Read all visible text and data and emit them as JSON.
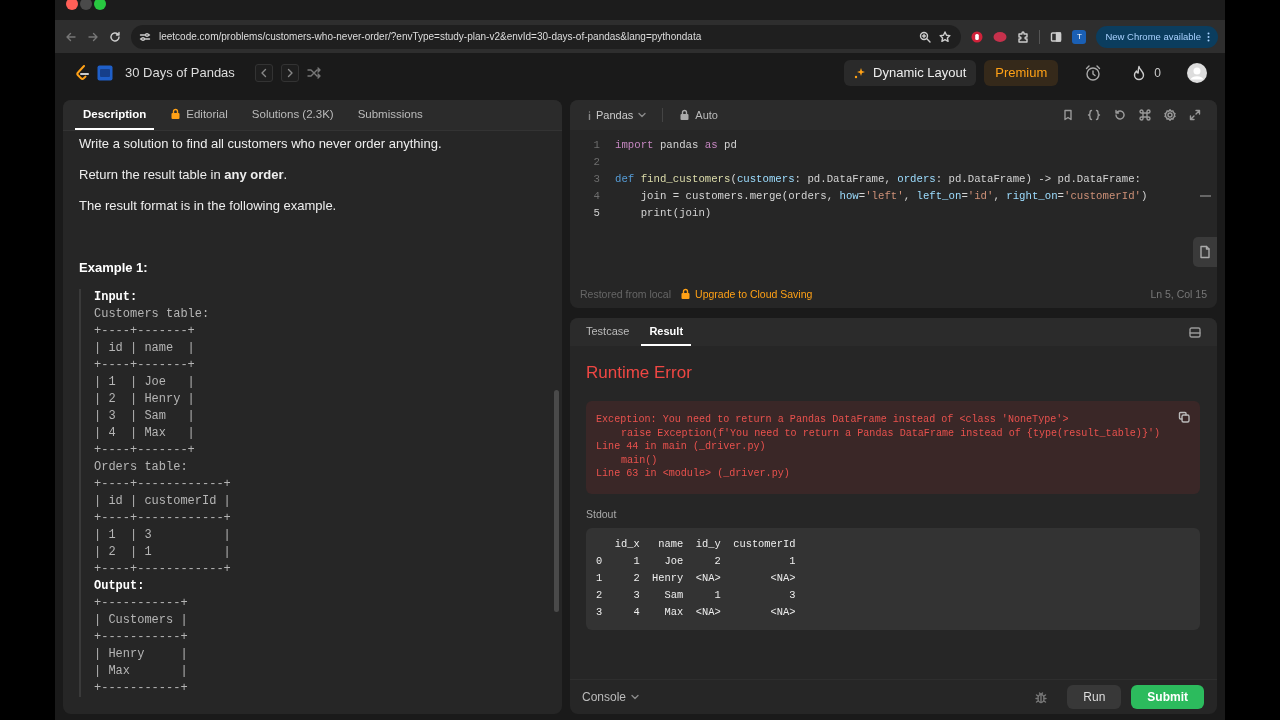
{
  "browser": {
    "url": "leetcode.com/problems/customers-who-never-order/?envType=study-plan-v2&envId=30-days-of-pandas&lang=pythondata",
    "profile_initial": "T",
    "update_button": "New Chrome available"
  },
  "header": {
    "title": "30 Days of Pandas",
    "dynamic_layout": "Dynamic Layout",
    "premium": "Premium",
    "streak": "0"
  },
  "description_tabs": [
    {
      "label": "Description",
      "selected": true,
      "locked": false
    },
    {
      "label": "Editorial",
      "selected": false,
      "locked": true
    },
    {
      "label": "Solutions (2.3K)",
      "selected": false,
      "locked": false
    },
    {
      "label": "Submissions",
      "selected": false,
      "locked": false
    }
  ],
  "description": {
    "paragraphs": [
      "Write a solution to find all customers who never order anything.",
      "Return the result table in **any order**.",
      "The result format is in the following example."
    ],
    "example_title": "Example 1:",
    "example_lines": [
      {
        "text": "Input:",
        "bold": true
      },
      {
        "text": "Customers table:",
        "bold": false
      },
      {
        "text": "+----+-------+",
        "bold": false
      },
      {
        "text": "| id | name  |",
        "bold": false
      },
      {
        "text": "+----+-------+",
        "bold": false
      },
      {
        "text": "| 1  | Joe   |",
        "bold": false
      },
      {
        "text": "| 2  | Henry |",
        "bold": false
      },
      {
        "text": "| 3  | Sam   |",
        "bold": false
      },
      {
        "text": "| 4  | Max   |",
        "bold": false
      },
      {
        "text": "+----+-------+",
        "bold": false
      },
      {
        "text": "Orders table:",
        "bold": false
      },
      {
        "text": "+----+------------+",
        "bold": false
      },
      {
        "text": "| id | customerId |",
        "bold": false
      },
      {
        "text": "+----+------------+",
        "bold": false
      },
      {
        "text": "| 1  | 3          |",
        "bold": false
      },
      {
        "text": "| 2  | 1          |",
        "bold": false
      },
      {
        "text": "+----+------------+",
        "bold": false
      },
      {
        "text": "Output:",
        "bold": true
      },
      {
        "text": "+-----------+",
        "bold": false
      },
      {
        "text": "| Customers |",
        "bold": false
      },
      {
        "text": "+-----------+",
        "bold": false
      },
      {
        "text": "| Henry     |",
        "bold": false
      },
      {
        "text": "| Max       |",
        "bold": false
      },
      {
        "text": "+-----------+",
        "bold": false
      }
    ]
  },
  "editor": {
    "language": "Pandas",
    "mode": "Auto",
    "lines": [
      {
        "number": "1",
        "active": false,
        "tokens": [
          {
            "text": "import",
            "kind": "keyword"
          },
          {
            "text": " pandas ",
            "kind": "plain"
          },
          {
            "text": "as",
            "kind": "keyword"
          },
          {
            "text": " pd",
            "kind": "plain"
          }
        ]
      },
      {
        "number": "2",
        "active": false
      },
      {
        "number": "3",
        "active": false,
        "tokens": [
          {
            "text": "def ",
            "kind": "storage"
          },
          {
            "text": "find_customers",
            "kind": "function"
          },
          {
            "text": "(",
            "kind": "plain"
          },
          {
            "text": "customers",
            "kind": "param"
          },
          {
            "text": ": pd.DataFrame, ",
            "kind": "plain"
          },
          {
            "text": "orders",
            "kind": "param"
          },
          {
            "text": ": pd.DataFrame) -> pd.DataFrame:",
            "kind": "plain"
          }
        ]
      },
      {
        "number": "4",
        "active": false,
        "tokens": [
          {
            "text": "    join = customers.merge(orders, ",
            "kind": "plain"
          },
          {
            "text": "how",
            "kind": "param"
          },
          {
            "text": "=",
            "kind": "plain"
          },
          {
            "text": "'left'",
            "kind": "string"
          },
          {
            "text": ", ",
            "kind": "plain"
          },
          {
            "text": "left_on",
            "kind": "param"
          },
          {
            "text": "=",
            "kind": "plain"
          },
          {
            "text": "'id'",
            "kind": "string"
          },
          {
            "text": ", ",
            "kind": "plain"
          },
          {
            "text": "right_on",
            "kind": "param"
          },
          {
            "text": "=",
            "kind": "plain"
          },
          {
            "text": "'customerId'",
            "kind": "string"
          },
          {
            "text": ")",
            "kind": "plain"
          }
        ]
      },
      {
        "number": "5",
        "active": true,
        "tokens": [
          {
            "text": "    print(join)",
            "kind": "plain"
          }
        ]
      }
    ],
    "saved_status": "Restored from local",
    "upgrade_link": "Upgrade to Cloud Saving",
    "cursor_position": "Ln 5, Col 15"
  },
  "result_tabs": [
    {
      "label": "Testcase",
      "selected": false
    },
    {
      "label": "Result",
      "selected": true
    }
  ],
  "result": {
    "title": "Runtime Error",
    "error_lines": [
      {
        "text": "Exception: You need to return a Pandas DataFrame instead of <class 'NoneType'>",
        "indented": false
      },
      {
        "text": "raise Exception(f'You need to return a Pandas DataFrame instead of {type(result_table)}')",
        "indented": true
      },
      {
        "text": "Line 44 in main (_driver.py)",
        "indented": false
      },
      {
        "text": "main()",
        "indented": true
      },
      {
        "text": "Line 63 in <module> (_driver.py)",
        "indented": false
      }
    ],
    "stdout_label": "Stdout",
    "stdout_lines": [
      "   id_x   name  id_y  customerId",
      "0     1    Joe     2           1",
      "1     2  Henry  <NA>        <NA>",
      "2     3    Sam     1           3",
      "3     4    Max  <NA>        <NA>"
    ]
  },
  "footer": {
    "console": "Console",
    "run": "Run",
    "submit": "Submit"
  }
}
